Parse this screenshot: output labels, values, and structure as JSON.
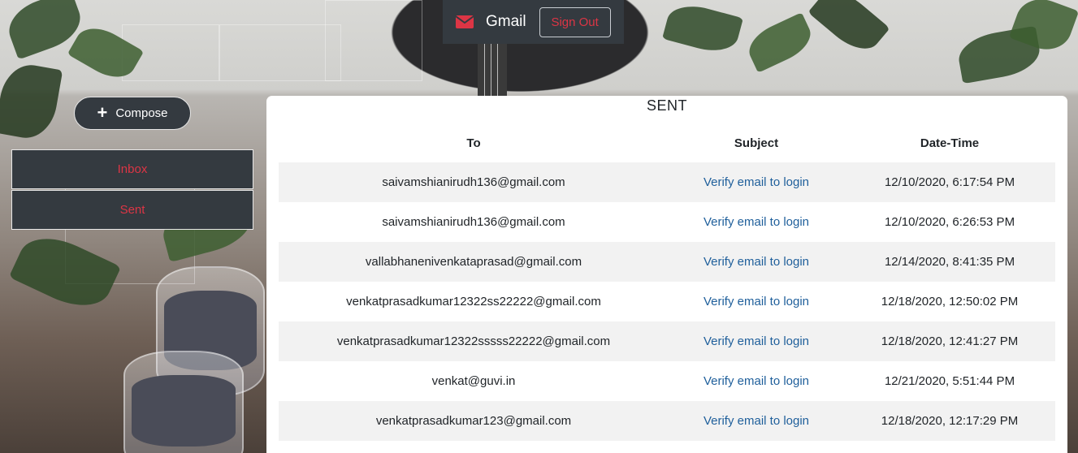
{
  "navbar": {
    "brand": "Gmail",
    "icon": "envelope-icon",
    "signout_label": "Sign Out",
    "accent": "#dc3545"
  },
  "sidebar": {
    "compose_label": "Compose",
    "items": [
      {
        "label": "Inbox"
      },
      {
        "label": "Sent"
      }
    ]
  },
  "main": {
    "title": "SENT",
    "columns": [
      "To",
      "Subject",
      "Date-Time"
    ],
    "rows": [
      {
        "to": "saivamshianirudh136@gmail.com",
        "subject": "Verify email to login",
        "datetime": "12/10/2020, 6:17:54 PM"
      },
      {
        "to": "saivamshianirudh136@gmail.com",
        "subject": "Verify email to login",
        "datetime": "12/10/2020, 6:26:53 PM"
      },
      {
        "to": "vallabhanenivenkataprasad@gmail.com",
        "subject": "Verify email to login",
        "datetime": "12/14/2020, 8:41:35 PM"
      },
      {
        "to": "venkatprasadkumar12322ss22222@gmail.com",
        "subject": "Verify email to login",
        "datetime": "12/18/2020, 12:50:02 PM"
      },
      {
        "to": "venkatprasadkumar12322sssss22222@gmail.com",
        "subject": "Verify email to login",
        "datetime": "12/18/2020, 12:41:27 PM"
      },
      {
        "to": "venkat@guvi.in",
        "subject": "Verify email to login",
        "datetime": "12/21/2020, 5:51:44 PM"
      },
      {
        "to": "venkatprasadkumar123@gmail.com",
        "subject": "Verify email to login",
        "datetime": "12/18/2020, 12:17:29 PM"
      }
    ]
  }
}
